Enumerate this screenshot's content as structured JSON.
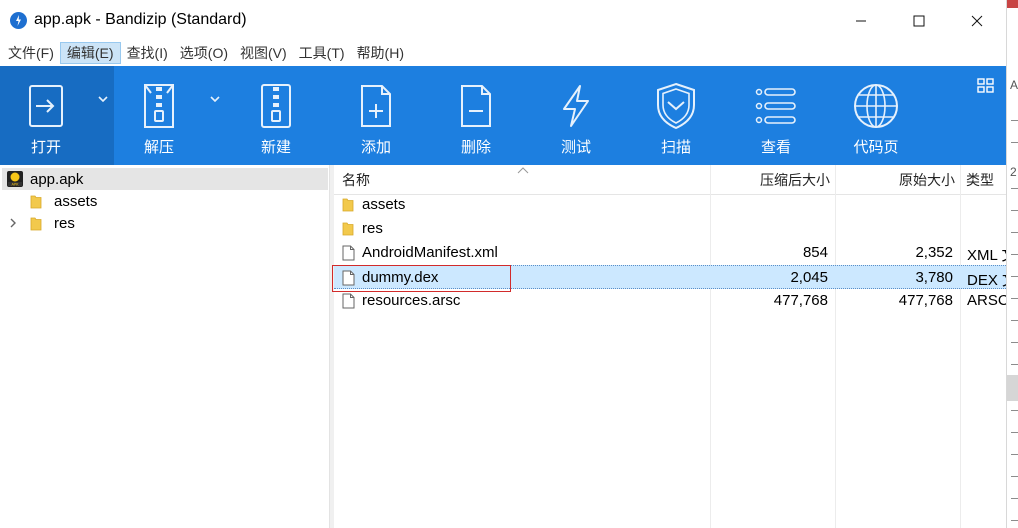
{
  "window": {
    "title": "app.apk - Bandizip (Standard)",
    "controls": {
      "minimize": "minimize",
      "maximize": "maximize",
      "close": "close"
    }
  },
  "menubar": {
    "items": [
      {
        "label": "文件(F)",
        "active": false
      },
      {
        "label": "编辑(E)",
        "active": true
      },
      {
        "label": "查找(I)",
        "active": false
      },
      {
        "label": "选项(O)",
        "active": false
      },
      {
        "label": "视图(V)",
        "active": false
      },
      {
        "label": "工具(T)",
        "active": false
      },
      {
        "label": "帮助(H)",
        "active": false
      }
    ]
  },
  "toolbar": {
    "open": "打开",
    "extract": "解压",
    "new": "新建",
    "add": "添加",
    "delete": "删除",
    "test": "测试",
    "scan": "扫描",
    "view": "查看",
    "codepage": "代码页",
    "icons": [
      "open-archive-icon",
      "extract-zip-icon",
      "new-zip-icon",
      "add-file-icon",
      "delete-file-icon",
      "test-lightning-icon",
      "scan-shield-icon",
      "view-list-icon",
      "codepage-globe-icon",
      "layout-grid-icon"
    ]
  },
  "tree": {
    "root": {
      "label": "app.apk",
      "badge": "APK"
    },
    "children": [
      {
        "label": "assets",
        "expandable": false
      },
      {
        "label": "res",
        "expandable": true
      }
    ]
  },
  "list": {
    "columns": {
      "name": "名称",
      "packed": "压缩后大小",
      "original": "原始大小",
      "type": "类型"
    },
    "sort": {
      "column": "name",
      "direction": "ascending"
    },
    "rows": [
      {
        "name": "assets",
        "kind": "folder",
        "packed": "",
        "original": "",
        "type": ""
      },
      {
        "name": "res",
        "kind": "folder",
        "packed": "",
        "original": "",
        "type": ""
      },
      {
        "name": "AndroidManifest.xml",
        "kind": "file",
        "packed": "854",
        "original": "2,352",
        "type": "XML 文"
      },
      {
        "name": "dummy.dex",
        "kind": "file",
        "packed": "2,045",
        "original": "3,780",
        "type": "DEX 文",
        "selected": true
      },
      {
        "name": "resources.arsc",
        "kind": "file",
        "packed": "477,768",
        "original": "477,768",
        "type": "ARSC"
      }
    ]
  },
  "background_strip": {
    "glyphs": [
      "A",
      "2"
    ]
  },
  "colors": {
    "toolbar": "#1d7fe0",
    "toolbar_active": "#176cc2",
    "selection": "#cce8ff",
    "highlight_box": "#d22b2b",
    "folder": "#f2c94c"
  }
}
